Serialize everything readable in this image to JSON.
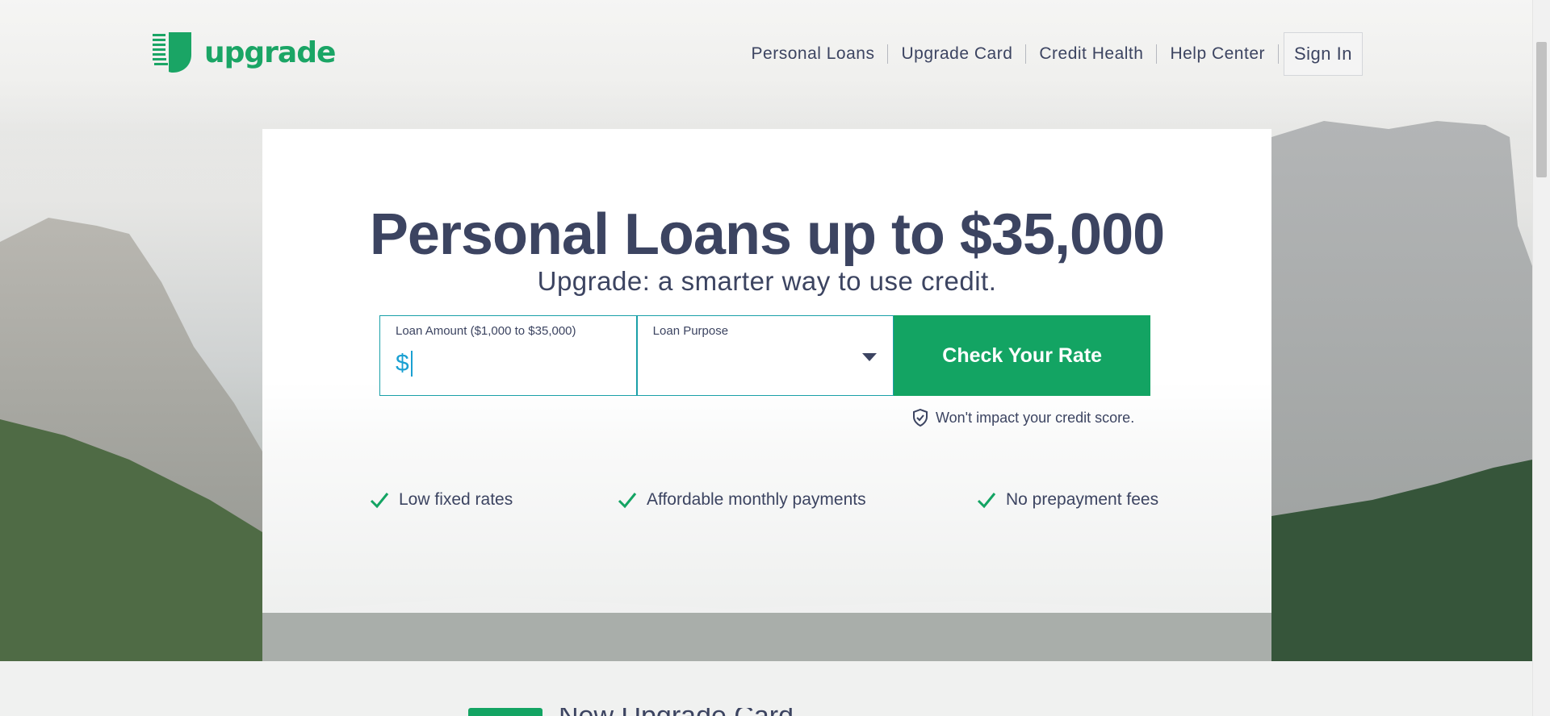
{
  "brand": {
    "name": "upgrade",
    "color": "#1aa565"
  },
  "nav": {
    "items": [
      "Personal Loans",
      "Upgrade Card",
      "Credit Health",
      "Help Center"
    ],
    "sign_in": "Sign In"
  },
  "hero": {
    "headline": "Personal Loans up to $35,000",
    "subhead": "Upgrade: a smarter way to use credit.",
    "amount_label": "Loan Amount ($1,000 to $35,000)",
    "amount_prefix": "$",
    "purpose_label": "Loan Purpose",
    "purpose_value": "",
    "cta": "Check Your Rate",
    "credit_note": "Won't impact your credit score.",
    "benefits": [
      "Low fixed rates",
      "Affordable monthly payments",
      "No prepayment fees"
    ]
  },
  "promo": {
    "text": "New Upgrade Card"
  },
  "colors": {
    "accent": "#13a463",
    "text": "#3c4461",
    "focus": "#1aa0d2"
  },
  "icons": [
    "upgrade-logo-icon",
    "dropdown-caret-icon",
    "shield-check-icon",
    "checkmark-icon"
  ]
}
